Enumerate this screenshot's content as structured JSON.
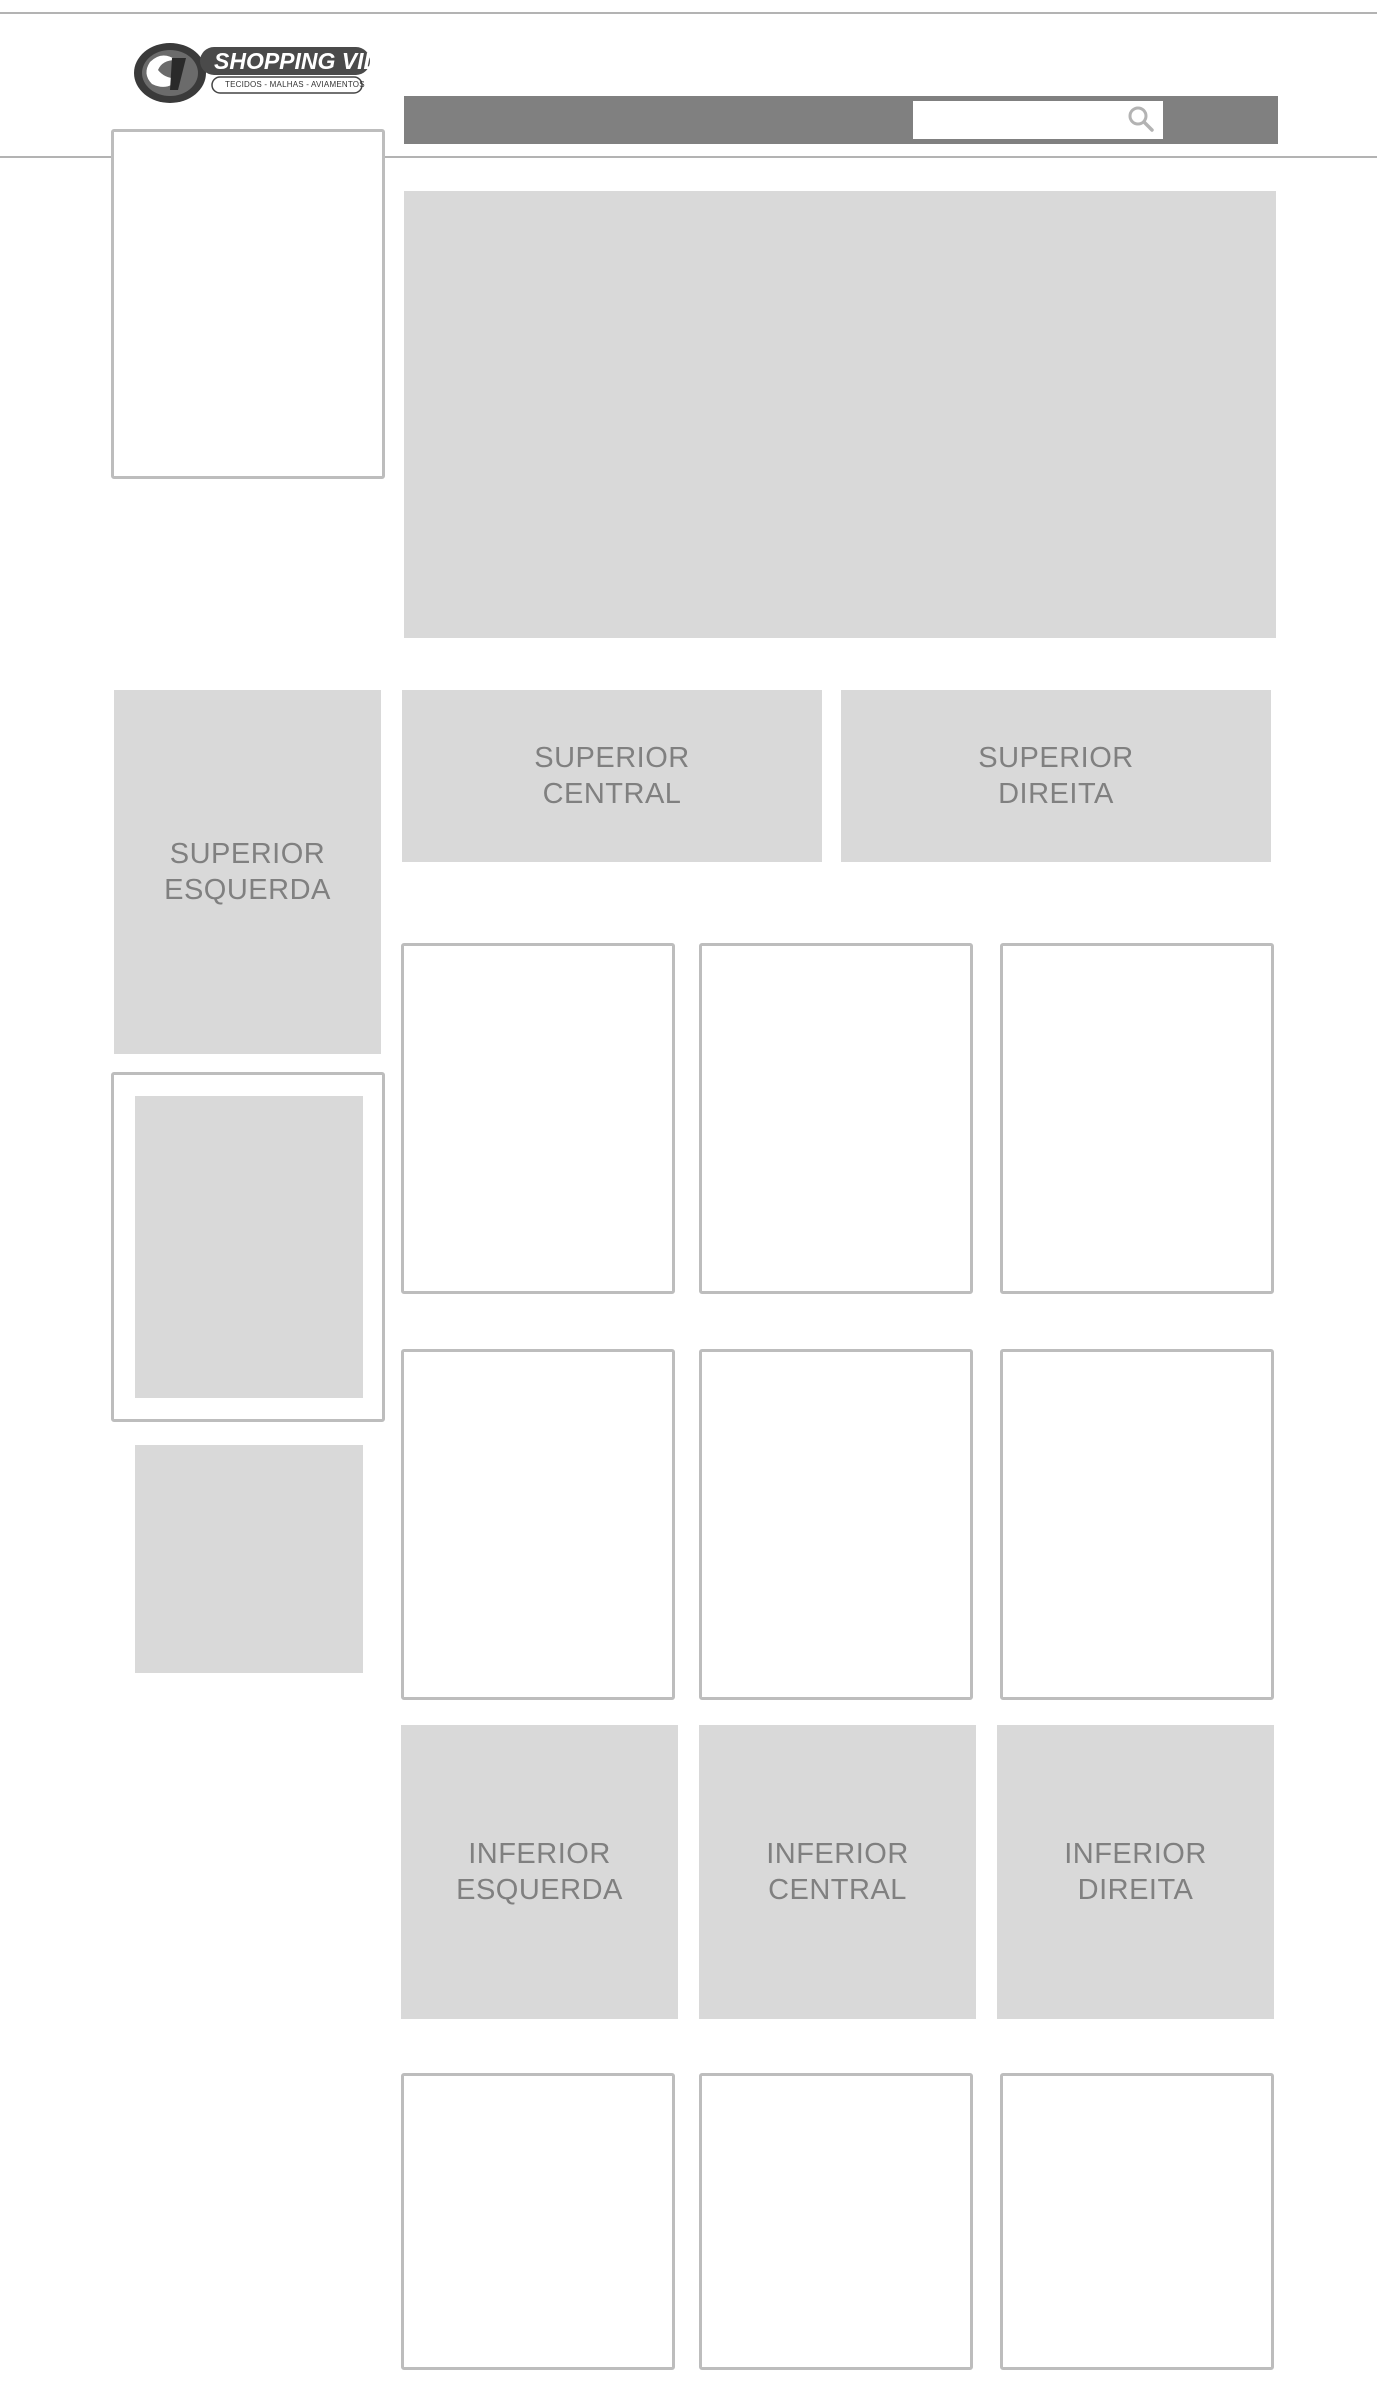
{
  "logo": {
    "name": "SHOPPING VIDA",
    "tagline": "TECIDOS - MALHAS - AVIAMENTOS"
  },
  "search": {
    "value": "",
    "placeholder": "",
    "icon": "search-icon"
  },
  "banners": {
    "superior_esquerda": "SUPERIOR\nESQUERDA",
    "superior_central": "SUPERIOR\nCENTRAL",
    "superior_direita": "SUPERIOR\nDIREITA",
    "inferior_esquerda": "INFERIOR\nESQUERDA",
    "inferior_central": "INFERIOR\nCENTRAL",
    "inferior_direita": "INFERIOR\nDIREITA"
  },
  "colors": {
    "placeholder_fill": "#d9d9d9",
    "outline": "#bdbdbd",
    "search_bar": "#808080",
    "label_text": "#808080"
  }
}
